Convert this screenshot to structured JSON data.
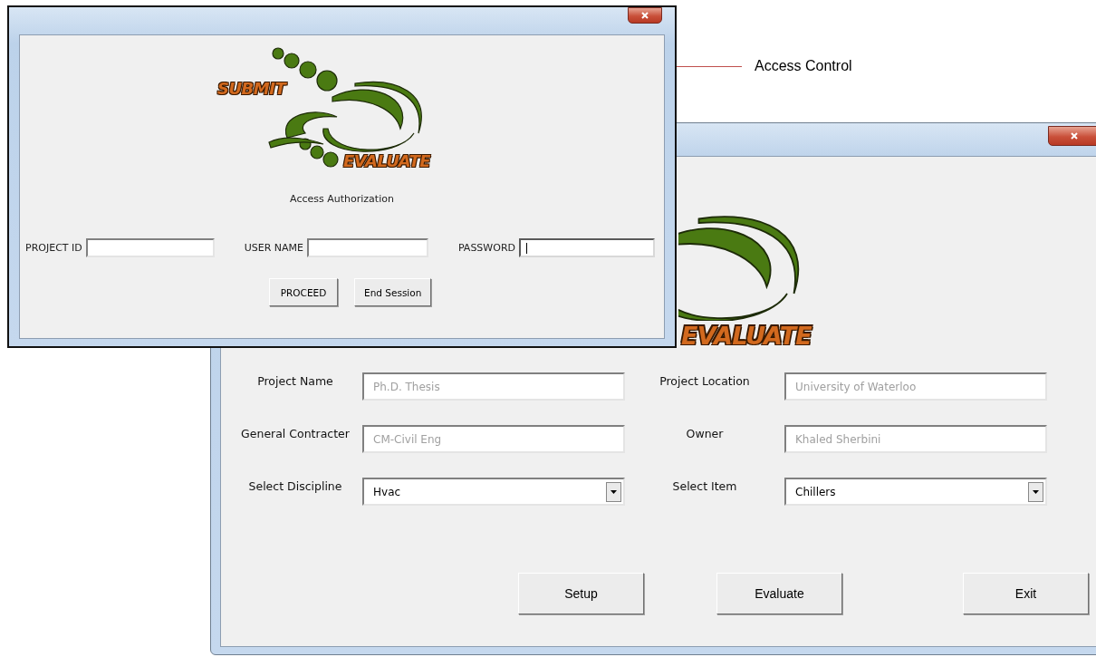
{
  "annotation": {
    "label": "Access Control"
  },
  "project_window": {
    "logo": {
      "bottom_word": "EVALUATE"
    },
    "fields": [
      {
        "kind": "text",
        "label": "Project Name",
        "value": "Ph.D. Thesis",
        "disabled": true
      },
      {
        "kind": "text",
        "label": "Project Location",
        "value": "University of Waterloo",
        "disabled": true
      },
      {
        "kind": "text",
        "label": "General Contracter",
        "value": "CM-Civil Eng",
        "disabled": true
      },
      {
        "kind": "text",
        "label": "Owner",
        "value": "Khaled Sherbini",
        "disabled": true
      },
      {
        "kind": "dropdown",
        "label": "Select Discipline",
        "value": "Hvac",
        "disabled": false
      },
      {
        "kind": "dropdown",
        "label": "Select Item",
        "value": "Chillers",
        "disabled": false
      }
    ],
    "buttons": [
      "Setup",
      "Evaluate",
      "Exit"
    ]
  },
  "access_window": {
    "logo": {
      "top_word": "SUBMIT",
      "bottom_word": "EVALUATE"
    },
    "heading": "Access Authorization",
    "fields": [
      {
        "label": "PROJECT ID",
        "focused": false
      },
      {
        "label": "USER NAME",
        "focused": false
      },
      {
        "label": "PASSWORD",
        "focused": true
      }
    ],
    "buttons": [
      "PROCEED",
      "End Session"
    ]
  }
}
